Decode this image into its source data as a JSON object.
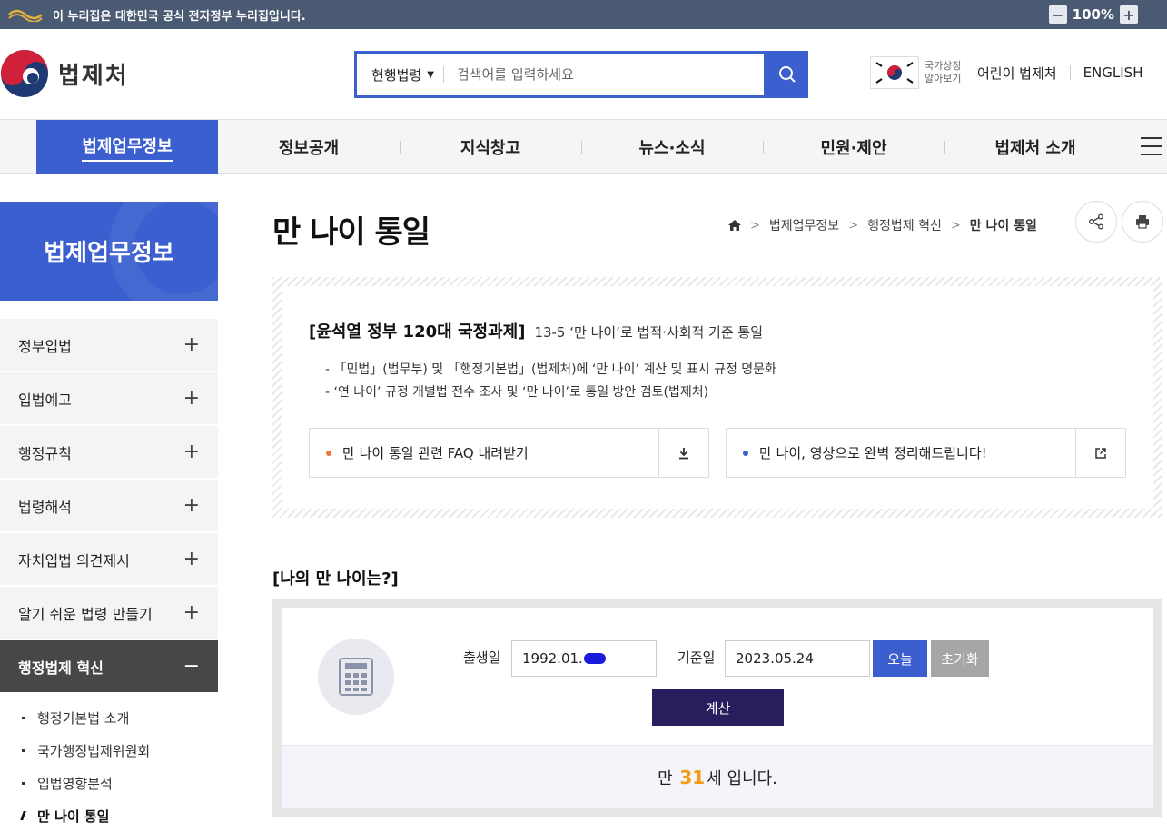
{
  "gov_banner": {
    "text": "이 누리집은 대한민국 공식 전자정부 누리집입니다.",
    "zoom": "100%",
    "zoom_minus": "−",
    "zoom_plus": "+"
  },
  "header": {
    "brand": "법제처",
    "search": {
      "scope": "현행법령",
      "placeholder": "검색어를 입력하세요"
    },
    "symbol_label_1": "국가상징",
    "symbol_label_2": "알아보기",
    "links": [
      "어린이 법제처",
      "ENGLISH"
    ]
  },
  "gnb": [
    "법제업무정보",
    "정보공개",
    "지식창고",
    "뉴스·소식",
    "민원·제안",
    "법제처 소개"
  ],
  "lnb": {
    "title": "법제업무정보",
    "items": [
      {
        "label": "정부입법",
        "icon": "+"
      },
      {
        "label": "입법예고",
        "icon": "+"
      },
      {
        "label": "행정규칙",
        "icon": "+"
      },
      {
        "label": "법령해석",
        "icon": "+"
      },
      {
        "label": "자치입법 의견제시",
        "icon": "+"
      },
      {
        "label": "알기 쉬운 법령 만들기",
        "icon": "+"
      },
      {
        "label": "행정법제 혁신",
        "icon": "−"
      }
    ],
    "sub_items": [
      "행정기본법 소개",
      "국가행정법제위원회",
      "입법영향분석",
      "만 나이 통일"
    ]
  },
  "page": {
    "title": "만 나이 통일",
    "breadcrumb": [
      "법제업무정보",
      "행정법제 혁신",
      "만 나이 통일"
    ]
  },
  "agenda": {
    "headline": "[윤석열 정부 120대 국정과제]",
    "sub": "13-5 ‘만 나이’로 법적·사회적 기준 통일",
    "bullets": [
      "- 「민법」(법무부) 및 「행정기본법」(법제처)에 ‘만 나이’ 계산 및 표시 규정 명문화",
      "- ‘연 나이’ 규정 개별법 전수 조사 및 ‘만 나이’로 통일 방안 검토(법제처)"
    ],
    "cards": [
      "만 나이 통일 관련 FAQ 내려받기",
      "만 나이, 영상으로 완벽 정리해드립니다!"
    ]
  },
  "calculator": {
    "section_title": "[나의 만 나이는?]",
    "birth_label": "출생일",
    "birth_value": "1992.01.",
    "base_label": "기준일",
    "base_value": "2023.05.24",
    "today_button": "오늘",
    "reset_button": "초기화",
    "calc_button": "계산",
    "result_prefix": "만",
    "result_age": "31",
    "result_suffix": "세 입니다."
  },
  "colors": {
    "primary": "#3b5fcf",
    "dark_button": "#2a1d5e",
    "accent": "#f39c12",
    "lnb_open": "#474747"
  }
}
